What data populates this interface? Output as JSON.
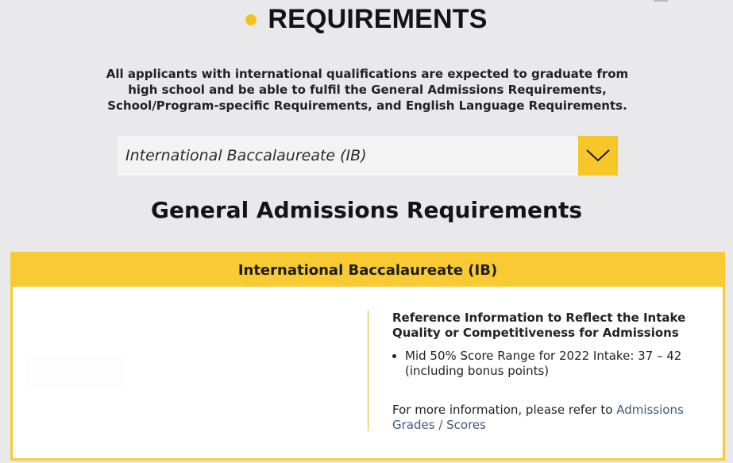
{
  "header": {
    "title": "REQUIREMENTS",
    "accent_color": "#f5c21b"
  },
  "intro": {
    "text": "All applicants with international qualifications are expected to graduate from high school and be able to fulfil the General Admissions Requirements, School/Program-specific Requirements, and English Language Requirements."
  },
  "qualification_select": {
    "selected": "International Baccalaureate (IB)",
    "button_icon": "chevron-down-icon",
    "button_color": "#f5c729"
  },
  "section": {
    "heading": "General Admissions Requirements"
  },
  "panel": {
    "header": "International Baccalaureate (IB)",
    "border_color": "#f8ca34",
    "reference": {
      "title": "Reference Information to Reflect the Intake Quality or Competitiveness for Admissions",
      "items": [
        "Mid 50% Score Range for 2022 Intake: 37 – 42 (including bonus points)"
      ],
      "more_prefix": "For more information, please refer to ",
      "more_link": "Admissions Grades / Scores"
    }
  }
}
